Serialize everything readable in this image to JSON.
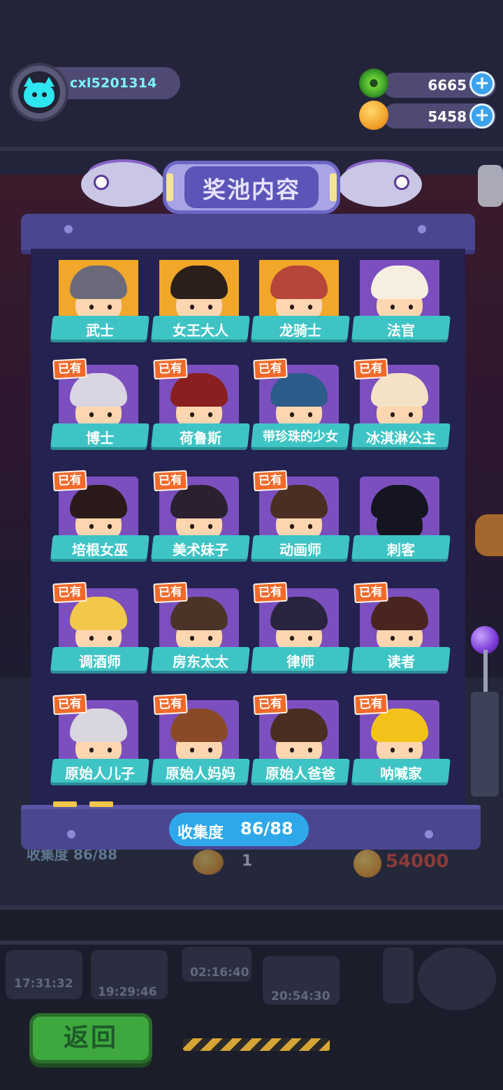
{
  "player": {
    "username": "cxl5201314",
    "avatar_icon": "cyan-cat-icon"
  },
  "resources": [
    {
      "name": "donut",
      "icon": "green-donut-icon",
      "value": "6665"
    },
    {
      "name": "coin",
      "icon": "planet-coin-icon",
      "value": "5458"
    }
  ],
  "plus_symbol": "+",
  "panel": {
    "title": "奖池内容",
    "owned_badge": "已有",
    "collection_label": "收集度",
    "collection_value": "86/88"
  },
  "characters": [
    {
      "name": "武士",
      "owned": true,
      "bg": "gold",
      "hair": "#6a6a7a",
      "badge_visible": false
    },
    {
      "name": "女王大人",
      "owned": true,
      "bg": "gold",
      "hair": "#2a1f1a",
      "badge_visible": false
    },
    {
      "name": "龙骑士",
      "owned": true,
      "bg": "gold",
      "hair": "#b7463a",
      "badge_visible": false
    },
    {
      "name": "法官",
      "owned": true,
      "bg": "purple",
      "hair": "#f6efe0",
      "badge_visible": false
    },
    {
      "name": "博士",
      "owned": true,
      "bg": "purple",
      "hair": "#d9d5e2",
      "badge_visible": true
    },
    {
      "name": "荷鲁斯",
      "owned": true,
      "bg": "purple",
      "hair": "#8a1f1f",
      "badge_visible": true
    },
    {
      "name": "带珍珠的少女",
      "owned": true,
      "bg": "purple",
      "hair": "#2d5b8a",
      "badge_visible": true
    },
    {
      "name": "冰淇淋公主",
      "owned": true,
      "bg": "purple",
      "hair": "#f4e2c6",
      "badge_visible": true
    },
    {
      "name": "培根女巫",
      "owned": true,
      "bg": "purple",
      "hair": "#2a1a1a",
      "badge_visible": true
    },
    {
      "name": "美术妹子",
      "owned": true,
      "bg": "purple",
      "hair": "#2a2030",
      "badge_visible": true
    },
    {
      "name": "动画师",
      "owned": true,
      "bg": "purple",
      "hair": "#4a2e22",
      "badge_visible": true
    },
    {
      "name": "刺客",
      "owned": false,
      "bg": "purple",
      "hair": "#151522",
      "badge_visible": false
    },
    {
      "name": "调酒师",
      "owned": true,
      "bg": "purple",
      "hair": "#f2c84a",
      "badge_visible": true
    },
    {
      "name": "房东太太",
      "owned": true,
      "bg": "purple",
      "hair": "#4a3428",
      "badge_visible": true
    },
    {
      "name": "律师",
      "owned": true,
      "bg": "purple",
      "hair": "#2a2440",
      "badge_visible": true
    },
    {
      "name": "读者",
      "owned": true,
      "bg": "purple",
      "hair": "#4a2420",
      "badge_visible": true
    },
    {
      "name": "原始人儿子",
      "owned": true,
      "bg": "purple",
      "hair": "#d8d6de",
      "badge_visible": true
    },
    {
      "name": "原始人妈妈",
      "owned": true,
      "bg": "purple",
      "hair": "#8a4a2a",
      "badge_visible": true
    },
    {
      "name": "原始人爸爸",
      "owned": true,
      "bg": "purple",
      "hair": "#4a2e22",
      "badge_visible": true
    },
    {
      "name": "呐喊家",
      "owned": true,
      "bg": "purple",
      "hair": "#f2c21a",
      "badge_visible": true
    }
  ],
  "background": {
    "faded_collection": "收集度 86/88",
    "faded_count": "1",
    "faded_coins": "54000",
    "timers": [
      "17:31:32",
      "19:29:46",
      "02:16:40",
      "20:54:30"
    ]
  },
  "back_button": "返回"
}
